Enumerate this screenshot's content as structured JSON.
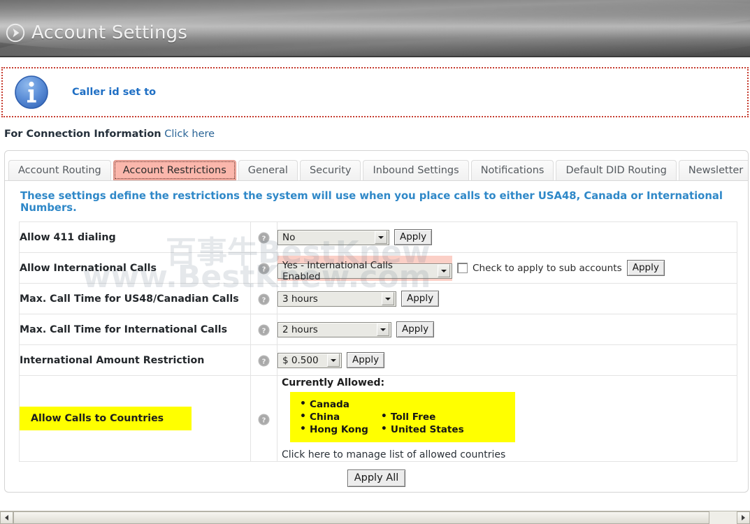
{
  "header": {
    "title": "Account Settings",
    "icon": "circled-arrow-icon"
  },
  "notice": {
    "icon": "info-icon",
    "text": "Caller id set to"
  },
  "connection": {
    "label": "For Connection Information",
    "link": "Click here"
  },
  "tabs": [
    {
      "label": "Account Routing",
      "active": false
    },
    {
      "label": "Account Restrictions",
      "active": true
    },
    {
      "label": "General",
      "active": false
    },
    {
      "label": "Security",
      "active": false
    },
    {
      "label": "Inbound Settings",
      "active": false
    },
    {
      "label": "Notifications",
      "active": false
    },
    {
      "label": "Default DID Routing",
      "active": false
    },
    {
      "label": "Newsletter",
      "active": false
    }
  ],
  "section": {
    "description": "These settings define the restrictions the system will use when you place calls to either USA48, Canada or International Numbers."
  },
  "rows": [
    {
      "label": "Allow 411 dialing",
      "help": "help-icon",
      "value": "No",
      "apply": "Apply"
    },
    {
      "label": "Allow International Calls",
      "help": "help-icon",
      "value": "Yes - International Calls Enabled",
      "checkbox_label": "Check to apply to sub accounts",
      "checkbox_checked": false,
      "apply": "Apply"
    },
    {
      "label": "Max. Call Time for US48/Canadian Calls",
      "help": "help-icon",
      "value": "3 hours",
      "apply": "Apply"
    },
    {
      "label": "Max. Call Time for International Calls",
      "help": "help-icon",
      "value": "2 hours",
      "apply": "Apply"
    },
    {
      "label": "International Amount Restriction",
      "help": "help-icon",
      "value": "$ 0.500",
      "apply": "Apply"
    }
  ],
  "countries_row": {
    "label": "Allow Calls to Countries",
    "help": "help-icon",
    "allowed_title": "Currently Allowed:",
    "column_1": [
      "Canada",
      "China",
      "Hong Kong"
    ],
    "column_2": [
      "Toll Free",
      "United States"
    ],
    "manage_link": "Click here to manage list of allowed countries"
  },
  "footer": {
    "apply_all": "Apply All"
  },
  "watermark": {
    "line1": "百事牛BestKnew",
    "line2": "www.BestKnew.com"
  },
  "colors": {
    "accent_blue": "#2f88c8",
    "link_blue": "#2a6496",
    "highlight_yellow": "#ffff00",
    "active_tab_pink": "#fbb7ac",
    "notice_border": "#c63b2e"
  },
  "scrollbar": {
    "left_arrow": "scroll-left-icon",
    "right_arrow": "scroll-right-icon"
  }
}
